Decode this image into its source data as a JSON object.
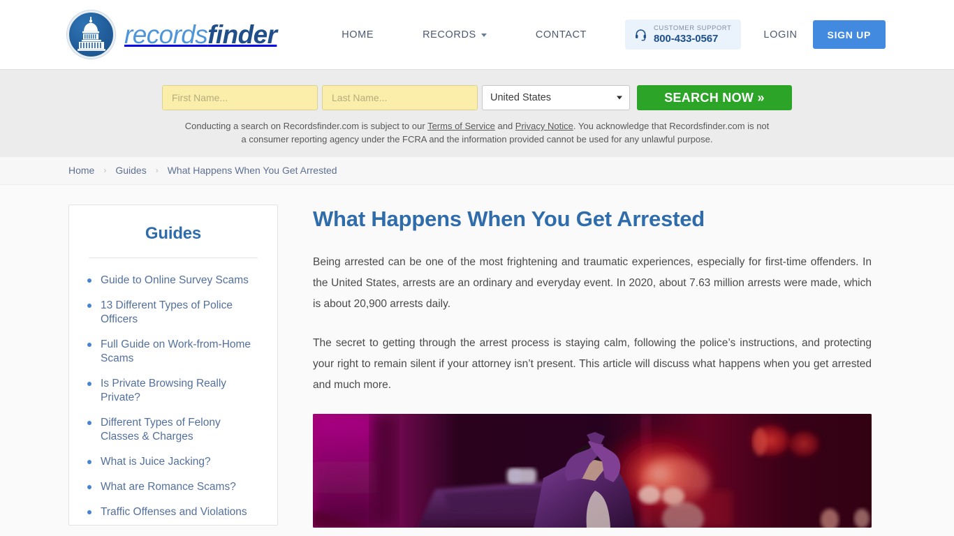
{
  "header": {
    "logo": {
      "icon": "capitol-dome-icon",
      "text_light": "records",
      "text_bold": "finder"
    },
    "nav": [
      {
        "label": "HOME",
        "has_caret": false
      },
      {
        "label": "RECORDS",
        "has_caret": true
      },
      {
        "label": "CONTACT",
        "has_caret": false
      }
    ],
    "support": {
      "icon": "headset-icon",
      "label": "CUSTOMER SUPPORT",
      "phone": "800-433-0567"
    },
    "login_label": "LOGIN",
    "signup_label": "SIGN UP",
    "signup_color": "#4289e0"
  },
  "search": {
    "first_name_placeholder": "First Name...",
    "first_name_value": "",
    "last_name_placeholder": "Last Name...",
    "last_name_value": "",
    "country_selected": "United States",
    "country_options": [
      "United States"
    ],
    "button_label": "SEARCH NOW »",
    "button_color": "#2ba428",
    "input_color": "#faeeaa",
    "disclaimer_part1": "Conducting a search on Recordsfinder.com is subject to our ",
    "disclaimer_link1": "Terms of Service",
    "disclaimer_part2": " and ",
    "disclaimer_link2": "Privacy Notice",
    "disclaimer_part3": ". You acknowledge that Recordsfinder.com is not a consumer reporting agency under the FCRA and the information provided cannot be used for any unlawful purpose."
  },
  "breadcrumb": {
    "items": [
      "Home",
      "Guides"
    ],
    "current": "What Happens When You Get Arrested",
    "separator": "›"
  },
  "sidebar": {
    "title": "Guides",
    "items": [
      {
        "label": "Guide to Online Survey Scams"
      },
      {
        "label": "13 Different Types of Police Officers"
      },
      {
        "label": "Full Guide on Work-from-Home Scams"
      },
      {
        "label": "Is Private Browsing Really Private?"
      },
      {
        "label": "Different Types of Felony Classes & Charges"
      },
      {
        "label": "What is Juice Jacking?"
      },
      {
        "label": "What are Romance Scams?"
      },
      {
        "label": "Traffic Offenses and Violations"
      }
    ]
  },
  "article": {
    "title": "What Happens When You Get Arrested",
    "paragraph1": "Being arrested can be one of the most frightening and traumatic experiences, especially for first-time offenders. In the United States, arrests are an ordinary and everyday event. In 2020, about 7.63 million arrests were made, which is about 20,900 arrests daily.",
    "paragraph2": "The secret to getting through the arrest process is staying calm, following the police’s instructions, and protecting your right to remain silent if your attorney isn’t present. This article will discuss what happens when you get arrested and much more.",
    "photo_alt": "Man with hands behind head in front of police car with red and magenta emergency lights"
  }
}
